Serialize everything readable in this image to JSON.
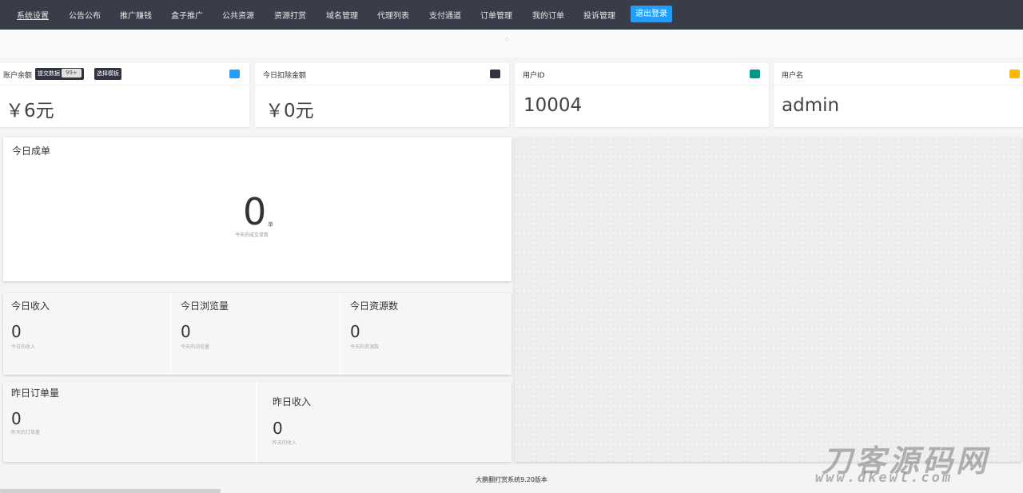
{
  "nav": {
    "items": [
      "系统设置",
      "公告公布",
      "推广赚钱",
      "盒子推广",
      "公共资源",
      "资源打赏",
      "域名管理",
      "代理列表",
      "支付通道",
      "订单管理",
      "我的订单",
      "投诉管理"
    ],
    "logout": "退出登录"
  },
  "cards": {
    "balance": {
      "title": "账户余额",
      "value": "￥6元",
      "pill1_label": "提交数据",
      "pill1_count": "99+",
      "pill2_label": "选择模板"
    },
    "today_deduct": {
      "title": "今日扣除金额",
      "value": "￥0元"
    },
    "user_id": {
      "title": "用户ID",
      "value": "10004"
    },
    "username": {
      "title": "用户名",
      "value": "admin"
    }
  },
  "today_orders": {
    "title": "今日成单",
    "value": "0",
    "unit": "单",
    "desc": "今天的成交单数"
  },
  "stats": [
    {
      "title": "今日收入",
      "value": "0",
      "desc": "今日的收入"
    },
    {
      "title": "今日浏览量",
      "value": "0",
      "desc": "今天的浏览量"
    },
    {
      "title": "今日资源数",
      "value": "0",
      "desc": "今天的资源数"
    }
  ],
  "yesterday": [
    {
      "title": "昨日订单量",
      "value": "0",
      "desc": "昨天的订单量"
    },
    {
      "title": "昨日收入",
      "value": "0",
      "desc": "昨天的收入"
    }
  ],
  "footer": "大鹏翻打赏系统9.20版本",
  "watermark": {
    "main": "刀客源码网",
    "sub": "www.dkewl.com"
  },
  "colors": {
    "nav_bg": "#393d49",
    "accent_blue": "#1e9fff",
    "badge_blue": "#1e9fff",
    "badge_dark": "#2f3440",
    "badge_green": "#009688",
    "badge_yellow": "#ffb800"
  }
}
